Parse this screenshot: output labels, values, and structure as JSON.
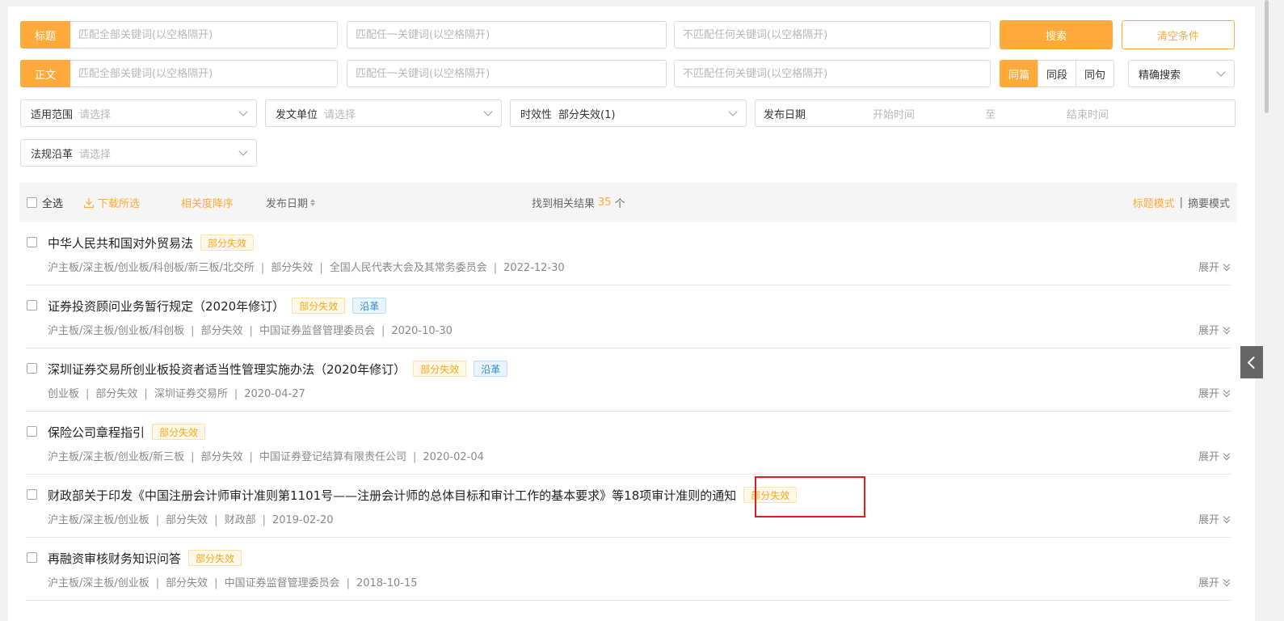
{
  "search": {
    "title_label": "标题",
    "body_label": "正文",
    "match_all_placeholder": "匹配全部关键词(以空格隔开)",
    "match_any_placeholder": "匹配任一关键词(以空格隔开)",
    "match_none_placeholder": "不匹配任何关键词(以空格隔开)",
    "search_button": "搜索",
    "clear_button": "清空条件",
    "scope_options": [
      "同篇",
      "同段",
      "同句"
    ],
    "mode_select": "精确搜索"
  },
  "filters": {
    "scope": {
      "label": "适用范围",
      "placeholder": "请选择"
    },
    "issuer": {
      "label": "发文单位",
      "placeholder": "请选择"
    },
    "validity": {
      "label": "时效性",
      "value": "部分失效(1)"
    },
    "date": {
      "label": "发布日期",
      "start": "开始时间",
      "to": "至",
      "end": "结束时间"
    },
    "history": {
      "label": "法规沿革",
      "placeholder": "请选择"
    }
  },
  "toolbar": {
    "select_all": "全选",
    "download": "下载所选",
    "sort_relevance": "相关度降序",
    "sort_date": "发布日期",
    "result_prefix": "找到相关结果",
    "result_count": "35",
    "result_suffix": "个",
    "title_mode": "标题模式",
    "divider": "|",
    "summary_mode": "摘要模式"
  },
  "results": [
    {
      "title": "中华人民共和国对外贸易法",
      "tags": [
        "部分失效"
      ],
      "boards": "沪主板/深主板/创业板/科创板/新三板/北交所",
      "status": "部分失效",
      "issuer": "全国人民代表大会及其常务委员会",
      "date": "2022-12-30",
      "expand": "展开"
    },
    {
      "title": "证券投资顾问业务暂行规定（2020年修订）",
      "tags": [
        "部分失效",
        "沿革"
      ],
      "boards": "沪主板/深主板/创业板/科创板",
      "status": "部分失效",
      "issuer": "中国证券监督管理委员会",
      "date": "2020-10-30",
      "expand": "展开"
    },
    {
      "title": "深圳证券交易所创业板投资者适当性管理实施办法（2020年修订）",
      "tags": [
        "部分失效",
        "沿革"
      ],
      "boards": "创业板",
      "status": "部分失效",
      "issuer": "深圳证券交易所",
      "date": "2020-04-27",
      "expand": "展开"
    },
    {
      "title": "保险公司章程指引",
      "tags": [
        "部分失效"
      ],
      "boards": "沪主板/深主板/创业板/新三板",
      "status": "部分失效",
      "issuer": "中国证券登记结算有限责任公司",
      "date": "2020-02-04",
      "expand": "展开"
    },
    {
      "title": "财政部关于印发《中国注册会计师审计准则第1101号——注册会计师的总体目标和审计工作的基本要求》等18项审计准则的通知",
      "tags": [
        "部分失效"
      ],
      "boards": "沪主板/深主板/创业板",
      "status": "部分失效",
      "issuer": "财政部",
      "date": "2019-02-20",
      "expand": "展开"
    },
    {
      "title": "再融资审核财务知识问答",
      "tags": [
        "部分失效"
      ],
      "boards": "沪主板/深主板/创业板",
      "status": "部分失效",
      "issuer": "中国证券监督管理委员会",
      "date": "2018-10-15",
      "expand": "展开"
    }
  ],
  "colors": {
    "accent": "#ffaa3b",
    "tag_yellow": "#f0a81e",
    "tag_blue": "#2e8bdd",
    "highlight": "#e02020"
  }
}
